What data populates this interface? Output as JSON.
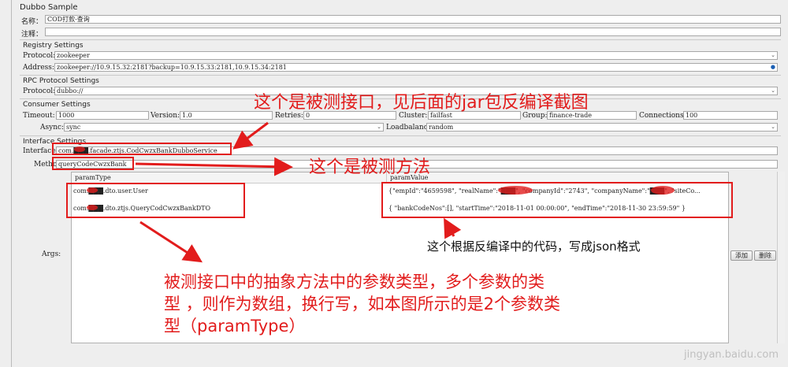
{
  "window": {
    "title": "Dubbo Sample"
  },
  "general": {
    "name_label": "名称：",
    "name_value": "COD打款-查询",
    "comment_label": "注释："
  },
  "registry": {
    "section": "Registry Settings",
    "protocol_label": "Protocol:",
    "protocol_value": "zookeeper",
    "address_label": "Address:",
    "address_value": "zookeeper://10.9.15.32:2181?backup=10.9.15.33:2181,10.9.15.34:2181"
  },
  "rpc": {
    "section": "RPC Protocol Settings",
    "protocol_label": "Protocol:",
    "protocol_value": "dubbo://"
  },
  "consumer": {
    "section": "Consumer Settings",
    "timeout_label": "Timeout:",
    "timeout_value": "1000",
    "version_label": "Version:",
    "version_value": "1.0",
    "retries_label": "Retries:",
    "retries_value": "0",
    "cluster_label": "Cluster:",
    "cluster_value": "failfast",
    "group_label": "Group:",
    "group_value": "finance-trade",
    "connections_label": "Connections:",
    "connections_value": "100",
    "async_label": "Async:",
    "async_value": "sync",
    "loadbalance_label": "Loadbalance:",
    "loadbalance_value": "random"
  },
  "interface": {
    "section": "Interface Settings",
    "interface_label": "Interface:",
    "interface_value": "com.███.facade.ztjs.CodCwzxBankDubboService",
    "method_label": "Method:",
    "method_value": "queryCodeCwzxBank"
  },
  "args": {
    "label": "Args:",
    "col_paramType": "paramType",
    "col_paramValue": "paramValue",
    "rows": [
      {
        "type": "com.███.dto.user.User",
        "value": "{\"empId\":\"4659598\", \"realName\":\"███\", \"companyId\":\"2743\", \"companyName\":\"███\", \"siteCo..."
      },
      {
        "type": "com.███.dto.ztjs.QueryCodCwzxBankDTO",
        "value": "{ \"bankCodeNos\":[], \"startTime\":\"2018-11-01 00:00:00\", \"endTime\":\"2018-11-30 23:59:59\" }"
      }
    ],
    "add_button": "添加",
    "delete_button": "删除"
  },
  "annotations": {
    "interface_note": "这个是被测接口，见后面的jar包反编译截图",
    "method_note": "这个是被测方法",
    "json_note": "这个根据反编译中的代码，写成json格式",
    "param_note_line1": "被测接口中的抽象方法中的参数类型，多个参数的类",
    "param_note_line2": "型 ，则作为数组，换行写，如本图所示的是2个参数类",
    "param_note_line3": "型（paramType）"
  },
  "watermark": "jingyan.baidu.com",
  "colors": {
    "annotation": "#e21c1c",
    "background": "#eeeeee"
  }
}
